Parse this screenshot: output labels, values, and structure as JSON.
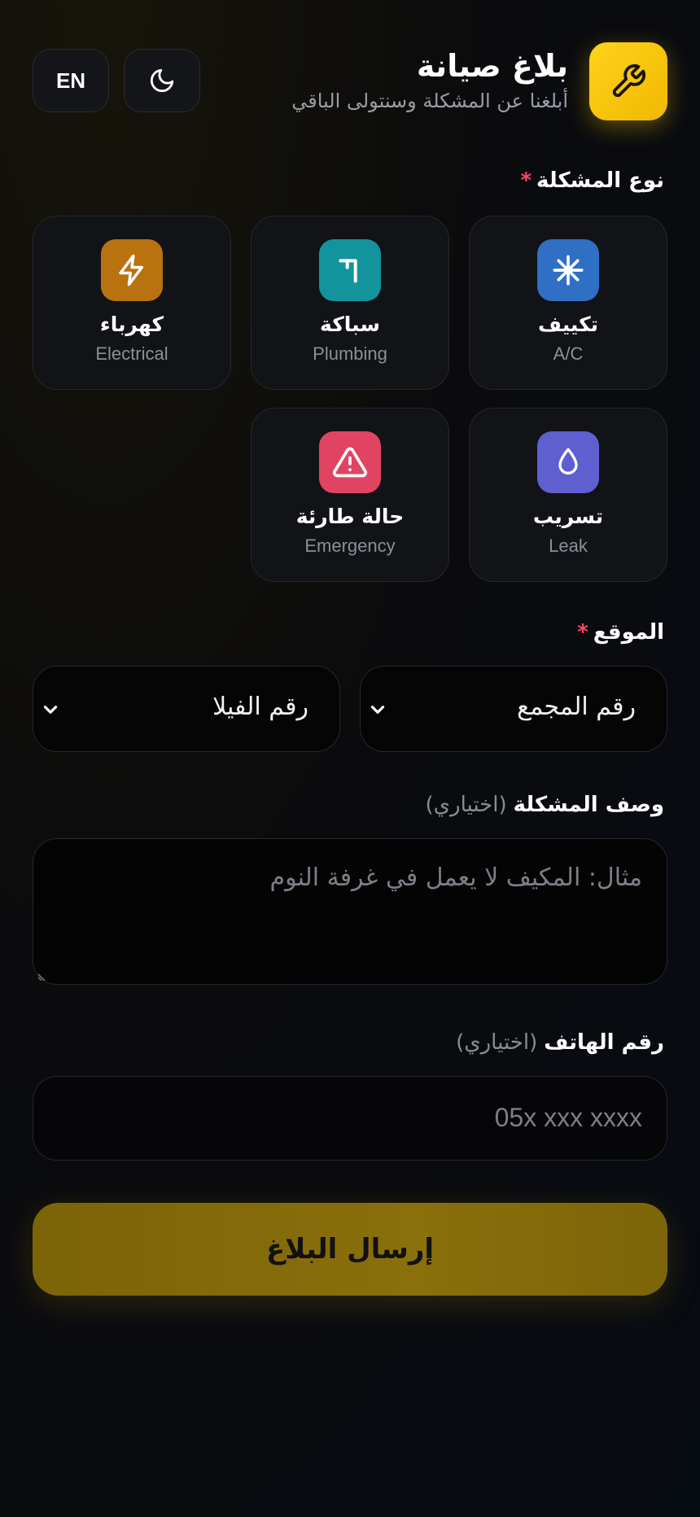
{
  "header": {
    "title": "بلاغ صيانة",
    "subtitle": "أبلغنا عن المشكلة وسنتولى الباقي",
    "lang_button": "EN",
    "brand_icon": "wrench-icon",
    "theme_icon": "moon-icon"
  },
  "problem_type": {
    "label": "نوع المشكلة",
    "required_mark": "*",
    "categories": [
      {
        "ar": "تكييف",
        "en": "A/C",
        "icon": "snowflake-icon",
        "color": "#2f6fc4"
      },
      {
        "ar": "سباكة",
        "en": "Plumbing",
        "icon": "pipe-icon",
        "color": "#13939c"
      },
      {
        "ar": "كهرباء",
        "en": "Electrical",
        "icon": "lightning-icon",
        "color": "#b8720f"
      },
      {
        "ar": "تسريب",
        "en": "Leak",
        "icon": "droplet-icon",
        "color": "#5f5fd0"
      },
      {
        "ar": "حالة طارئة",
        "en": "Emergency",
        "icon": "warning-icon",
        "color": "#e04461"
      }
    ]
  },
  "location": {
    "label": "الموقع",
    "required_mark": "*",
    "compound_select": "رقم المجمع",
    "villa_select": "رقم الفيلا"
  },
  "description": {
    "label": "وصف المشكلة",
    "optional": "(اختياري)",
    "placeholder": "مثال: المكيف لا يعمل في غرفة النوم"
  },
  "phone": {
    "label": "رقم الهاتف",
    "optional": "(اختياري)",
    "placeholder": "05x xxx xxxx"
  },
  "submit_label": "إرسال البلاغ",
  "colors": {
    "accent": "#ffd21a",
    "required": "#ff4563"
  }
}
